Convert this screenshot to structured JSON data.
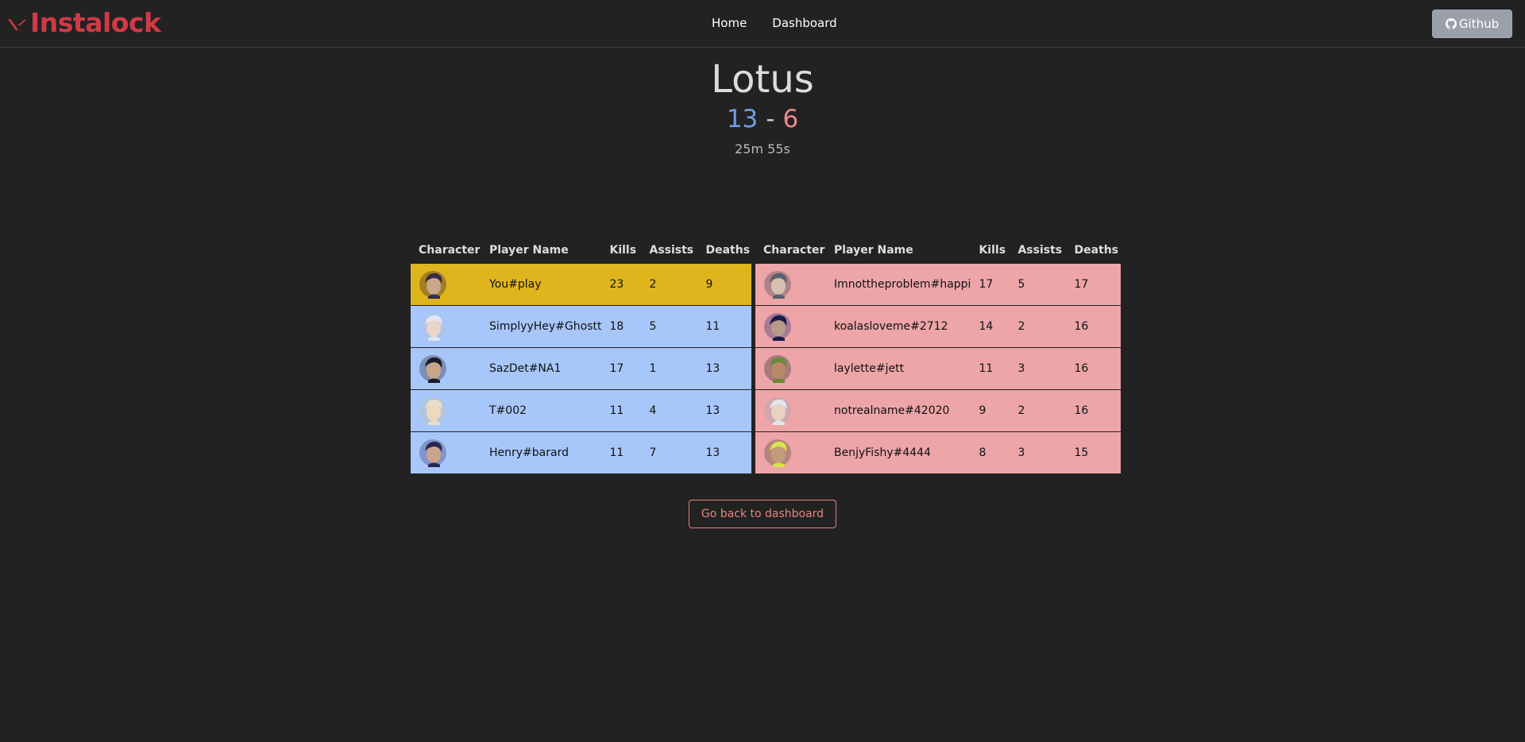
{
  "nav": {
    "brand": "Instalock",
    "links": [
      "Home",
      "Dashboard"
    ],
    "github_label": "Github"
  },
  "match": {
    "map": "Lotus",
    "score_ally": "13",
    "score_separator": "-",
    "score_enemy": "6",
    "duration": "25m 55s"
  },
  "columns": [
    "Character",
    "Player Name",
    "Kills",
    "Assists",
    "Deaths"
  ],
  "team_left": [
    {
      "player": "You#play",
      "kills": "23",
      "assists": "2",
      "deaths": "9",
      "highlight": true
    },
    {
      "player": "SimplyyHey#Ghostt",
      "kills": "18",
      "assists": "5",
      "deaths": "11"
    },
    {
      "player": "SazDet#NA1",
      "kills": "17",
      "assists": "1",
      "deaths": "13"
    },
    {
      "player": "T#002",
      "kills": "11",
      "assists": "4",
      "deaths": "13"
    },
    {
      "player": "Henry#barard",
      "kills": "11",
      "assists": "7",
      "deaths": "13"
    }
  ],
  "team_right": [
    {
      "player": "Imnottheproblem#happi",
      "kills": "17",
      "assists": "5",
      "deaths": "17"
    },
    {
      "player": "koalasloveme#2712",
      "kills": "14",
      "assists": "2",
      "deaths": "16"
    },
    {
      "player": "laylette#jett",
      "kills": "11",
      "assists": "3",
      "deaths": "16"
    },
    {
      "player": "notrealname#42020",
      "kills": "9",
      "assists": "2",
      "deaths": "16"
    },
    {
      "player": "BenjyFishy#4444",
      "kills": "8",
      "assists": "3",
      "deaths": "15"
    }
  ],
  "back_button": "Go back to dashboard",
  "colors": {
    "brand": "#d03a46",
    "ally_row": "#a7c7fb",
    "self_row": "#dfb51d",
    "enemy_row": "#eda5a8",
    "score_ally": "#6f9ee8",
    "score_enemy": "#ec8a8a"
  }
}
